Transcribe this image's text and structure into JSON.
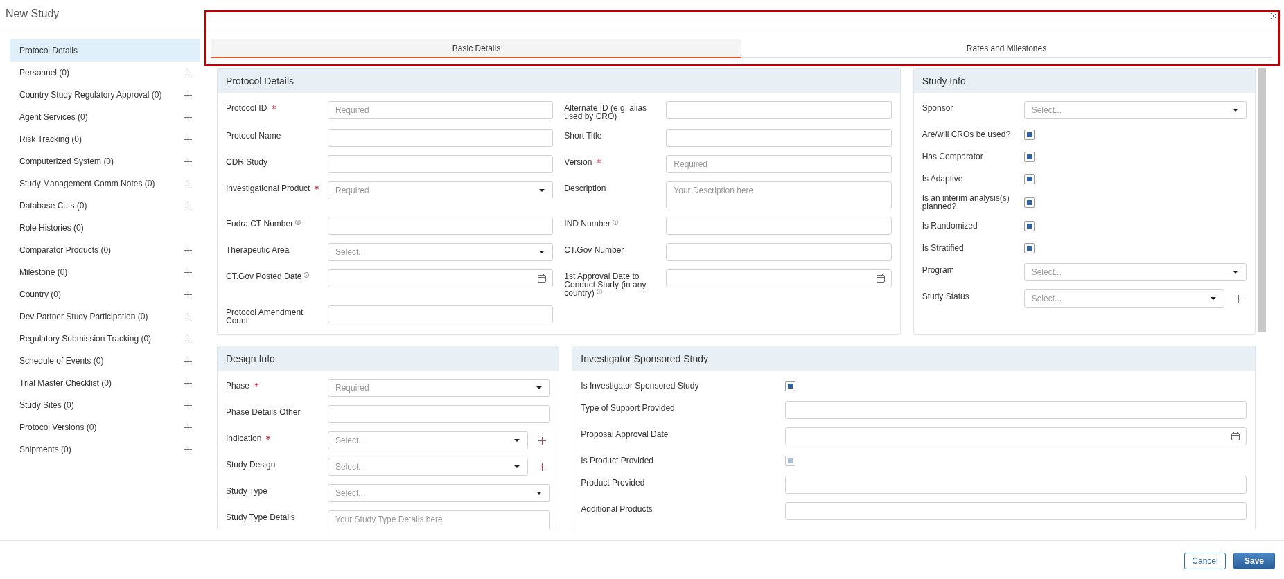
{
  "window": {
    "title": "New Study"
  },
  "sidebar": {
    "items": [
      {
        "label": "Protocol Details",
        "selected": true,
        "add_button": false
      },
      {
        "label": "Personnel (0)",
        "selected": false,
        "add_button": true
      },
      {
        "label": "Country Study Regulatory Approval (0)",
        "selected": false,
        "add_button": true
      },
      {
        "label": "Agent Services (0)",
        "selected": false,
        "add_button": true
      },
      {
        "label": "Risk Tracking (0)",
        "selected": false,
        "add_button": true
      },
      {
        "label": "Computerized System (0)",
        "selected": false,
        "add_button": true
      },
      {
        "label": "Study Management Comm Notes (0)",
        "selected": false,
        "add_button": true
      },
      {
        "label": "Database Cuts (0)",
        "selected": false,
        "add_button": true
      },
      {
        "label": "Role Histories (0)",
        "selected": false,
        "add_button": false
      },
      {
        "label": "Comparator Products (0)",
        "selected": false,
        "add_button": true
      },
      {
        "label": "Milestone (0)",
        "selected": false,
        "add_button": true
      },
      {
        "label": "Country (0)",
        "selected": false,
        "add_button": true
      },
      {
        "label": "Dev Partner Study Participation (0)",
        "selected": false,
        "add_button": true
      },
      {
        "label": "Regulatory Submission Tracking (0)",
        "selected": false,
        "add_button": true
      },
      {
        "label": "Schedule of Events (0)",
        "selected": false,
        "add_button": true
      },
      {
        "label": "Trial Master Checklist (0)",
        "selected": false,
        "add_button": true
      },
      {
        "label": "Study Sites (0)",
        "selected": false,
        "add_button": true
      },
      {
        "label": "Protocol Versions (0)",
        "selected": false,
        "add_button": true
      },
      {
        "label": "Shipments (0)",
        "selected": false,
        "add_button": true
      }
    ]
  },
  "tabs": [
    {
      "label": "Basic Details",
      "selected": true
    },
    {
      "label": "Rates and Milestones",
      "selected": false
    }
  ],
  "panels": [
    {
      "kind": "protocol",
      "title": "Protocol Details",
      "fields": [
        {
          "label": "Protocol ID",
          "kind": "text",
          "placeholder": "Required",
          "required": true,
          "info": false,
          "add_button": false
        },
        {
          "label": "Alternate ID (e.g. alias used by CRO)",
          "kind": "text",
          "required": false,
          "info": false,
          "add_button": false
        },
        {
          "label": "Protocol Name",
          "kind": "text",
          "required": false,
          "info": false,
          "add_button": false
        },
        {
          "label": "Short Title",
          "kind": "text",
          "required": false,
          "info": false,
          "add_button": false
        },
        {
          "label": "CDR Study",
          "kind": "text",
          "required": false,
          "info": false,
          "add_button": false
        },
        {
          "label": "Version",
          "kind": "text",
          "placeholder": "Required",
          "required": true,
          "info": false,
          "add_button": false
        },
        {
          "label": "Investigational Product",
          "kind": "select",
          "placeholder": "Required",
          "required": true,
          "info": false,
          "add_button": false
        },
        {
          "label": "Description",
          "kind": "textarea",
          "placeholder": "Your Description here",
          "required": false,
          "info": false,
          "add_button": false
        },
        {
          "label": "Eudra CT Number",
          "kind": "text",
          "required": false,
          "info": true,
          "add_button": false
        },
        {
          "label": "IND Number",
          "kind": "text",
          "required": false,
          "info": true,
          "add_button": false
        },
        {
          "label": "Therapeutic Area",
          "kind": "select",
          "placeholder": "Select...",
          "required": false,
          "info": false,
          "add_button": false
        },
        {
          "label": "CT.Gov Number",
          "kind": "text",
          "required": false,
          "info": false,
          "add_button": false
        },
        {
          "label": "CT.Gov Posted Date",
          "kind": "date",
          "required": false,
          "info": true,
          "add_button": false
        },
        {
          "label": "1st Approval Date to Conduct Study (in any country)",
          "kind": "date",
          "required": false,
          "info": true,
          "add_button": false
        },
        {
          "label": "Protocol Amendment Count",
          "kind": "text",
          "required": false,
          "info": false,
          "add_button": false
        }
      ]
    },
    {
      "kind": "study_info",
      "title": "Study Info",
      "fields": [
        {
          "label": "Sponsor",
          "kind": "select",
          "placeholder": "Select...",
          "required": false,
          "info": false,
          "add_button": false
        },
        {
          "label": "Are/will CROs be used?",
          "kind": "checkbox",
          "checked": true,
          "disabled": false,
          "required": false,
          "info": false,
          "add_button": false
        },
        {
          "label": "Has Comparator",
          "kind": "checkbox",
          "checked": true,
          "disabled": false,
          "required": false,
          "info": false,
          "add_button": false
        },
        {
          "label": "Is Adaptive",
          "kind": "checkbox",
          "checked": true,
          "disabled": false,
          "required": false,
          "info": false,
          "add_button": false
        },
        {
          "label": "Is an interim analysis(s) planned?",
          "kind": "checkbox",
          "checked": true,
          "disabled": false,
          "required": false,
          "info": false,
          "add_button": false
        },
        {
          "label": "Is Randomized",
          "kind": "checkbox",
          "checked": true,
          "disabled": false,
          "required": false,
          "info": false,
          "add_button": false
        },
        {
          "label": "Is Stratified",
          "kind": "checkbox",
          "checked": true,
          "disabled": false,
          "required": false,
          "info": false,
          "add_button": false
        },
        {
          "label": "Program",
          "kind": "select",
          "placeholder": "Select...",
          "required": false,
          "info": false,
          "add_button": false
        },
        {
          "label": "Study Status",
          "kind": "select",
          "placeholder": "Select...",
          "required": false,
          "info": false,
          "add_button": true
        }
      ]
    },
    {
      "kind": "design",
      "title": "Design Info",
      "fields": [
        {
          "label": "Phase",
          "kind": "select",
          "placeholder": "Required",
          "required": true,
          "info": false,
          "add_button": false
        },
        {
          "label": "Phase Details Other",
          "kind": "text",
          "required": false,
          "info": false,
          "add_button": false
        },
        {
          "label": "Indication",
          "kind": "select",
          "placeholder": "Select...",
          "required": true,
          "info": false,
          "add_button": true
        },
        {
          "label": "Study Design",
          "kind": "select",
          "placeholder": "Select...",
          "required": false,
          "info": false,
          "add_button": true
        },
        {
          "label": "Study Type",
          "kind": "select",
          "placeholder": "Select...",
          "required": false,
          "info": false,
          "add_button": false
        },
        {
          "label": "Study Type Details",
          "kind": "textarea",
          "placeholder": "Your Study Type Details here",
          "required": false,
          "info": false,
          "add_button": false
        }
      ]
    },
    {
      "kind": "investigator",
      "title": "Investigator Sponsored Study",
      "fields": [
        {
          "label": "Is Investigator Sponsored Study",
          "kind": "checkbox",
          "checked": true,
          "disabled": false,
          "required": false,
          "info": false,
          "add_button": false
        },
        {
          "label": "Type of Support Provided",
          "kind": "text",
          "required": false,
          "info": false,
          "add_button": false
        },
        {
          "label": "Proposal Approval Date",
          "kind": "date",
          "required": false,
          "info": false,
          "add_button": false
        },
        {
          "label": "Is Product Provided",
          "kind": "checkbox",
          "checked": true,
          "disabled": true,
          "required": false,
          "info": false,
          "add_button": false
        },
        {
          "label": "Product Provided",
          "kind": "text",
          "required": false,
          "info": false,
          "add_button": false
        },
        {
          "label": "Additional Products",
          "kind": "text",
          "required": false,
          "info": false,
          "add_button": false
        }
      ]
    }
  ],
  "footer": {
    "buttons": [
      {
        "label": "Cancel",
        "kind": "secondary"
      },
      {
        "label": "Save",
        "kind": "primary"
      }
    ]
  }
}
